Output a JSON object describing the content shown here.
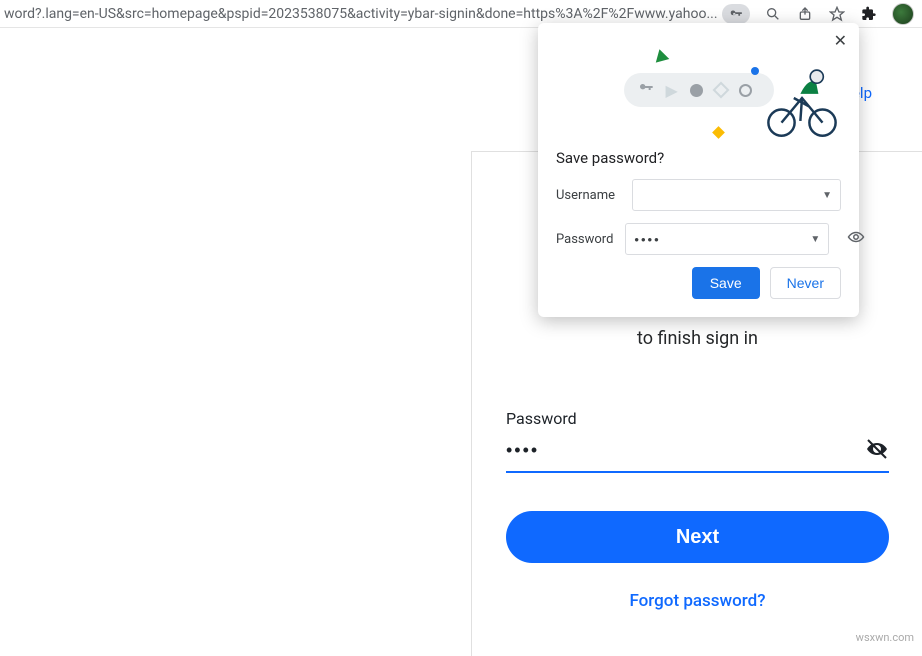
{
  "addrbar": {
    "url_fragment": "word?.lang=en-US&src=homepage&pspid=2023538075&activity=ybar-signin&done=https%3A%2F%2Fwww.yahoo..."
  },
  "page": {
    "help_link": "elp",
    "watermark": "wsxwn.com"
  },
  "signin": {
    "subtitle": "to finish sign in",
    "password_label": "Password",
    "password_value": "••••",
    "next_label": "Next",
    "forgot_label": "Forgot password?"
  },
  "save_dialog": {
    "title": "Save password?",
    "username_label": "Username",
    "username_value": "",
    "password_label": "Password",
    "password_value": "••••",
    "save_label": "Save",
    "never_label": "Never"
  }
}
